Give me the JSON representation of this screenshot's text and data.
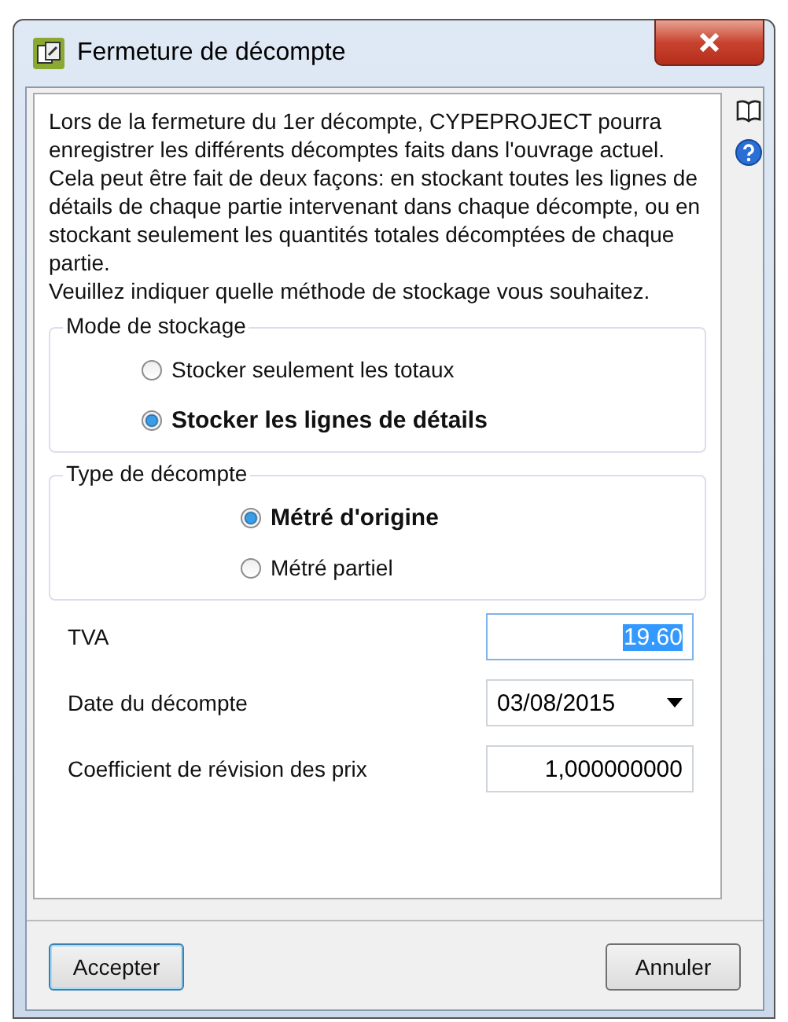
{
  "window": {
    "title": "Fermeture de décompte"
  },
  "description": [
    "Lors de la fermeture du 1er décompte, CYPEPROJECT pourra enregistrer les différents décomptes faits dans l'ouvrage actuel. Cela peut être fait de deux façons: en stockant toutes les lignes de détails de chaque partie intervenant dans chaque décompte, ou en stockant seulement les quantités totales décomptées de chaque partie.",
    "Veuillez indiquer quelle méthode de stockage vous souhaitez."
  ],
  "groups": [
    {
      "title": "Mode de stockage",
      "options": [
        {
          "label": "Stocker seulement les totaux",
          "selected": false
        },
        {
          "label": "Stocker les lignes de détails",
          "selected": true
        }
      ]
    },
    {
      "title": "Type de décompte",
      "options": [
        {
          "label": "Métré d'origine",
          "selected": true
        },
        {
          "label": "Métré partiel",
          "selected": false
        }
      ]
    }
  ],
  "fields": [
    {
      "kind": "text",
      "label": "TVA",
      "value": "19.60",
      "focused": true
    },
    {
      "kind": "date",
      "label": "Date du décompte",
      "value": "03/08/2015",
      "focused": false
    },
    {
      "kind": "text",
      "label": "Coefficient de révision des prix",
      "value": "1,000000000",
      "focused": false
    }
  ],
  "buttons": [
    {
      "label": "Accepter",
      "focused": true
    },
    {
      "label": "Annuler",
      "focused": false
    }
  ]
}
